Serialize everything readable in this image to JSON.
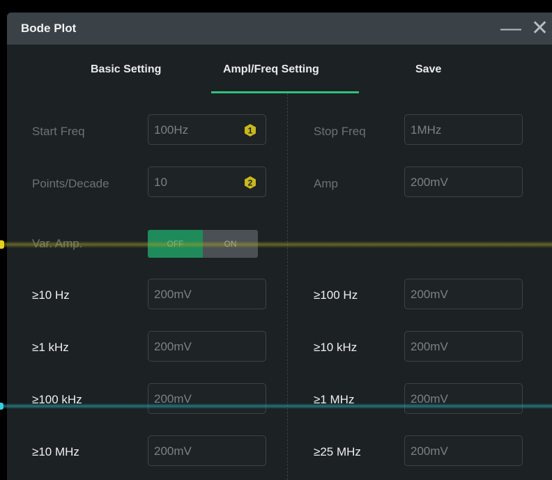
{
  "window": {
    "title": "Bode Plot",
    "minimize_glyph": "—",
    "close_glyph": "✕"
  },
  "tabs": [
    {
      "label": "Basic Setting",
      "active": false
    },
    {
      "label": "Ampl/Freq Setting",
      "active": true
    },
    {
      "label": "Save",
      "active": false
    }
  ],
  "accent_color": "#2fc27a",
  "form": {
    "start_freq": {
      "label": "Start Freq",
      "value": "100Hz",
      "badge": "1"
    },
    "stop_freq": {
      "label": "Stop Freq",
      "value": "1MHz"
    },
    "points_per_decade": {
      "label": "Points/Decade",
      "value": "10",
      "badge": "2"
    },
    "amp": {
      "label": "Amp",
      "value": "200mV"
    },
    "var_amp": {
      "label": "Var. Amp.",
      "off_label": "OFF",
      "on_label": "ON",
      "state": "OFF"
    }
  },
  "amplitude_rows": [
    {
      "left_label": "≥10 Hz",
      "left_value": "200mV",
      "right_label": "≥100 Hz",
      "right_value": "200mV"
    },
    {
      "left_label": "≥1 kHz",
      "left_value": "200mV",
      "right_label": "≥10 kHz",
      "right_value": "200mV"
    },
    {
      "left_label": "≥100 kHz",
      "left_value": "200mV",
      "right_label": "≥1 MHz",
      "right_value": "200mV"
    },
    {
      "left_label": "≥10 MHz",
      "left_value": "200mV",
      "right_label": "≥25 MHz",
      "right_value": "200mV"
    }
  ]
}
